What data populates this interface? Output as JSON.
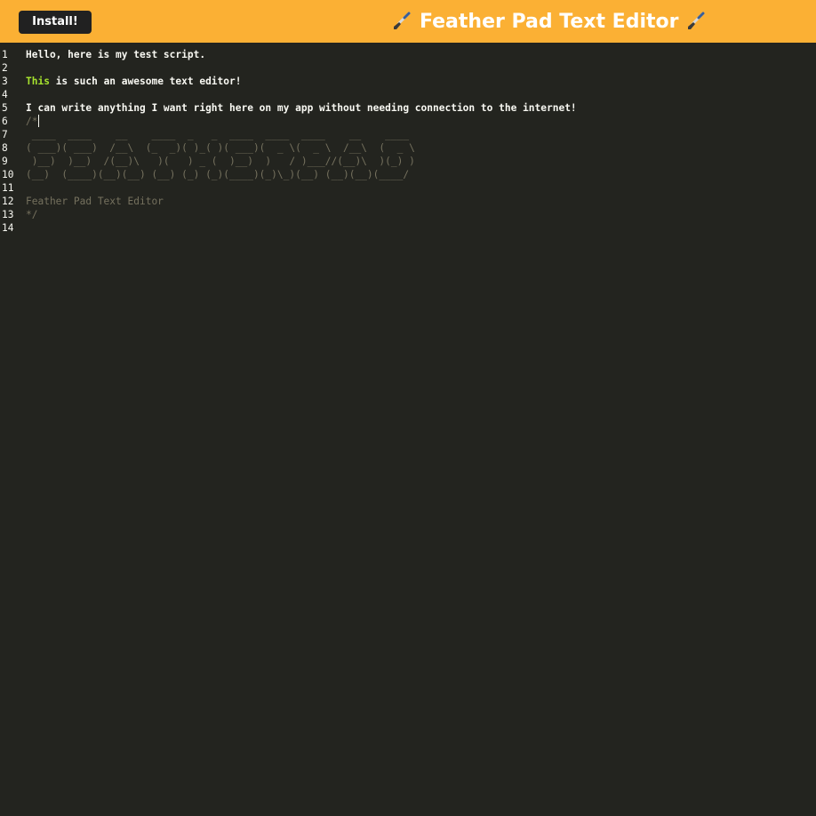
{
  "header": {
    "install_label": "Install!",
    "title": "Feather Pad Text Editor",
    "background": "#fbb034",
    "icon_left": "paintbrush-icon",
    "icon_right": "paintbrush-icon"
  },
  "editor": {
    "background": "#23241f",
    "text_color": "#f8f8f2",
    "comment_color": "#75715e",
    "keyword_color": "#a6e22e",
    "lines": [
      {
        "num": "1",
        "text": "Hello, here is my test script."
      },
      {
        "num": "2",
        "text": ""
      },
      {
        "num": "3",
        "keyword": "This",
        "text": " is such an awesome text editor!"
      },
      {
        "num": "4",
        "text": ""
      },
      {
        "num": "5",
        "text": "I can write anything I want right here on my app without needing connection to the internet!"
      },
      {
        "num": "6",
        "text": "/*"
      },
      {
        "num": "7",
        "text": " ____  ____    __    ____  _   _  ____  ____  ____    __    ____ "
      },
      {
        "num": "8",
        "text": "( ___)( ___)  /__\\  (_  _)( )_( )( ___)(  _ \\(  _ \\  /__\\  (  _ \\"
      },
      {
        "num": "9",
        "text": " )__)  )__)  /(__)\\   )(   ) _ (  )__)  )   / )___//(__)\\  )(_) )"
      },
      {
        "num": "10",
        "text": "(__)  (____)(__)(__) (__) (_) (_)(____)(_)\\_)(__) (__)(__)(____/"
      },
      {
        "num": "11",
        "text": ""
      },
      {
        "num": "12",
        "text": "Feather Pad Text Editor"
      },
      {
        "num": "13",
        "text": "*/"
      },
      {
        "num": "14",
        "text": ""
      }
    ]
  }
}
